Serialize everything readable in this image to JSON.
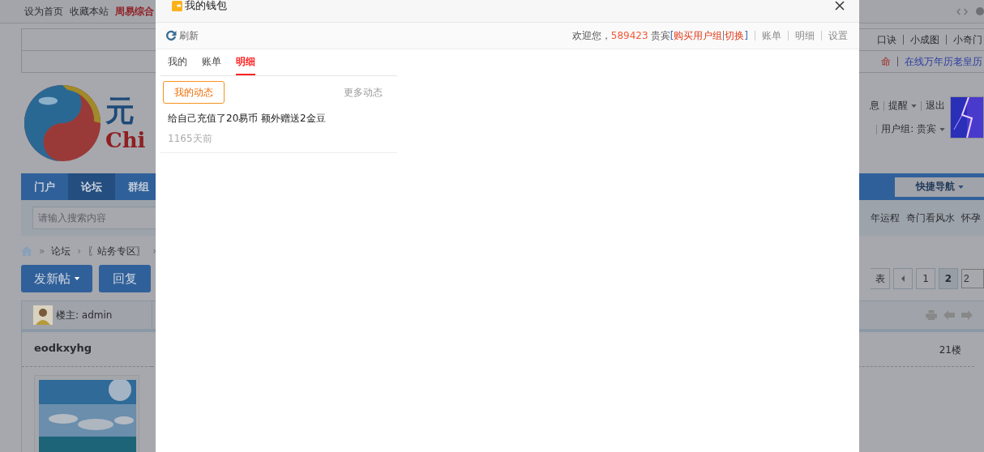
{
  "topbar": {
    "links": [
      {
        "label": "设为首页",
        "highlight": false
      },
      {
        "label": "收藏本站",
        "highlight": false
      },
      {
        "label": "周易综合",
        "highlight": true
      }
    ]
  },
  "link_table": {
    "rows": [
      {
        "links": [
          {
            "label": "口诀",
            "color": "#2b2c31"
          },
          {
            "label": "小成图",
            "color": "#2b2c31"
          },
          {
            "label": "小奇门",
            "color": "#2b2c31"
          }
        ]
      },
      {
        "links": [
          {
            "label": "命",
            "color": "#a02828"
          },
          {
            "label": "在线万年历老皇历",
            "color": "#2a3aa0"
          }
        ]
      }
    ]
  },
  "logo": {
    "text_cn": "元",
    "text_en": "Chi"
  },
  "user_menu": {
    "links": [
      {
        "label": "息",
        "dropdown": false
      },
      {
        "label": "提醒",
        "dropdown": true
      },
      {
        "label": "退出",
        "dropdown": false
      }
    ],
    "group": {
      "label": "用户组: 贵宾",
      "dropdown": true
    }
  },
  "nav": {
    "tabs": [
      {
        "label": "门户",
        "selected": false
      },
      {
        "label": "论坛",
        "selected": true
      },
      {
        "label": "群组",
        "selected": false
      }
    ],
    "quick_nav": "快捷导航"
  },
  "search": {
    "placeholder": "请输入搜索内容",
    "hot_words": [
      "年运程",
      "奇门看风水",
      "怀孕"
    ]
  },
  "breadcrumb": [
    {
      "kind": "separator",
      "label": "»"
    },
    {
      "kind": "link",
      "label": "论坛"
    },
    {
      "kind": "separator",
      "label": "›"
    },
    {
      "kind": "link",
      "label": "〖站务专区〗"
    },
    {
      "kind": "separator",
      "label": "›"
    }
  ],
  "actions": {
    "new_post": "发新帖",
    "reply": "回复"
  },
  "pagination": {
    "list": "表",
    "pages": [
      {
        "label": "1",
        "selected": false
      },
      {
        "label": "2",
        "selected": true
      }
    ],
    "page_input": "2"
  },
  "post": {
    "author_label": "楼主: admin",
    "username": "eodkxyhg",
    "floor": "21楼"
  },
  "dialog": {
    "title": "我的钱包",
    "refresh": "刷新",
    "welcome": "欢迎您，",
    "user_id": "589423",
    "user_group": "贵宾",
    "bracket_open": "[",
    "bracket_links": [
      "购买用户组",
      "切换"
    ],
    "bracket_close": "]",
    "menu_links": [
      "账单",
      "明细",
      "设置"
    ],
    "tabs": [
      {
        "label": "我的",
        "selected": false
      },
      {
        "label": "账单",
        "selected": false
      },
      {
        "label": "明细",
        "selected": true
      }
    ],
    "filters": [
      {
        "label": "我的动态",
        "selected": true
      }
    ],
    "more": "更多动态",
    "entries": [
      {
        "text": "给自己充值了20易币 额外赠送2金豆",
        "time": "1165天前"
      }
    ]
  }
}
